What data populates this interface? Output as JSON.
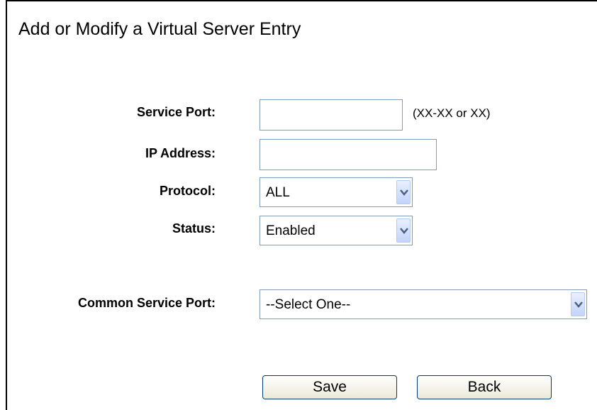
{
  "page": {
    "title": "Add or Modify a Virtual Server Entry"
  },
  "form": {
    "service_port": {
      "label": "Service Port:",
      "value": "",
      "hint": "(XX-XX or XX)"
    },
    "ip_address": {
      "label": "IP Address:",
      "value": ""
    },
    "protocol": {
      "label": "Protocol:",
      "selected": "ALL"
    },
    "status": {
      "label": "Status:",
      "selected": "Enabled"
    },
    "common_service_port": {
      "label": "Common Service Port:",
      "selected": "--Select One--"
    }
  },
  "buttons": {
    "save_label": "Save",
    "back_label": "Back"
  },
  "icons": {
    "dropdown": "chevron-down-icon"
  },
  "colors": {
    "input_border": "#7f9db9",
    "dropdown_button": "#c3d4fb",
    "button_border": "#003c74"
  }
}
